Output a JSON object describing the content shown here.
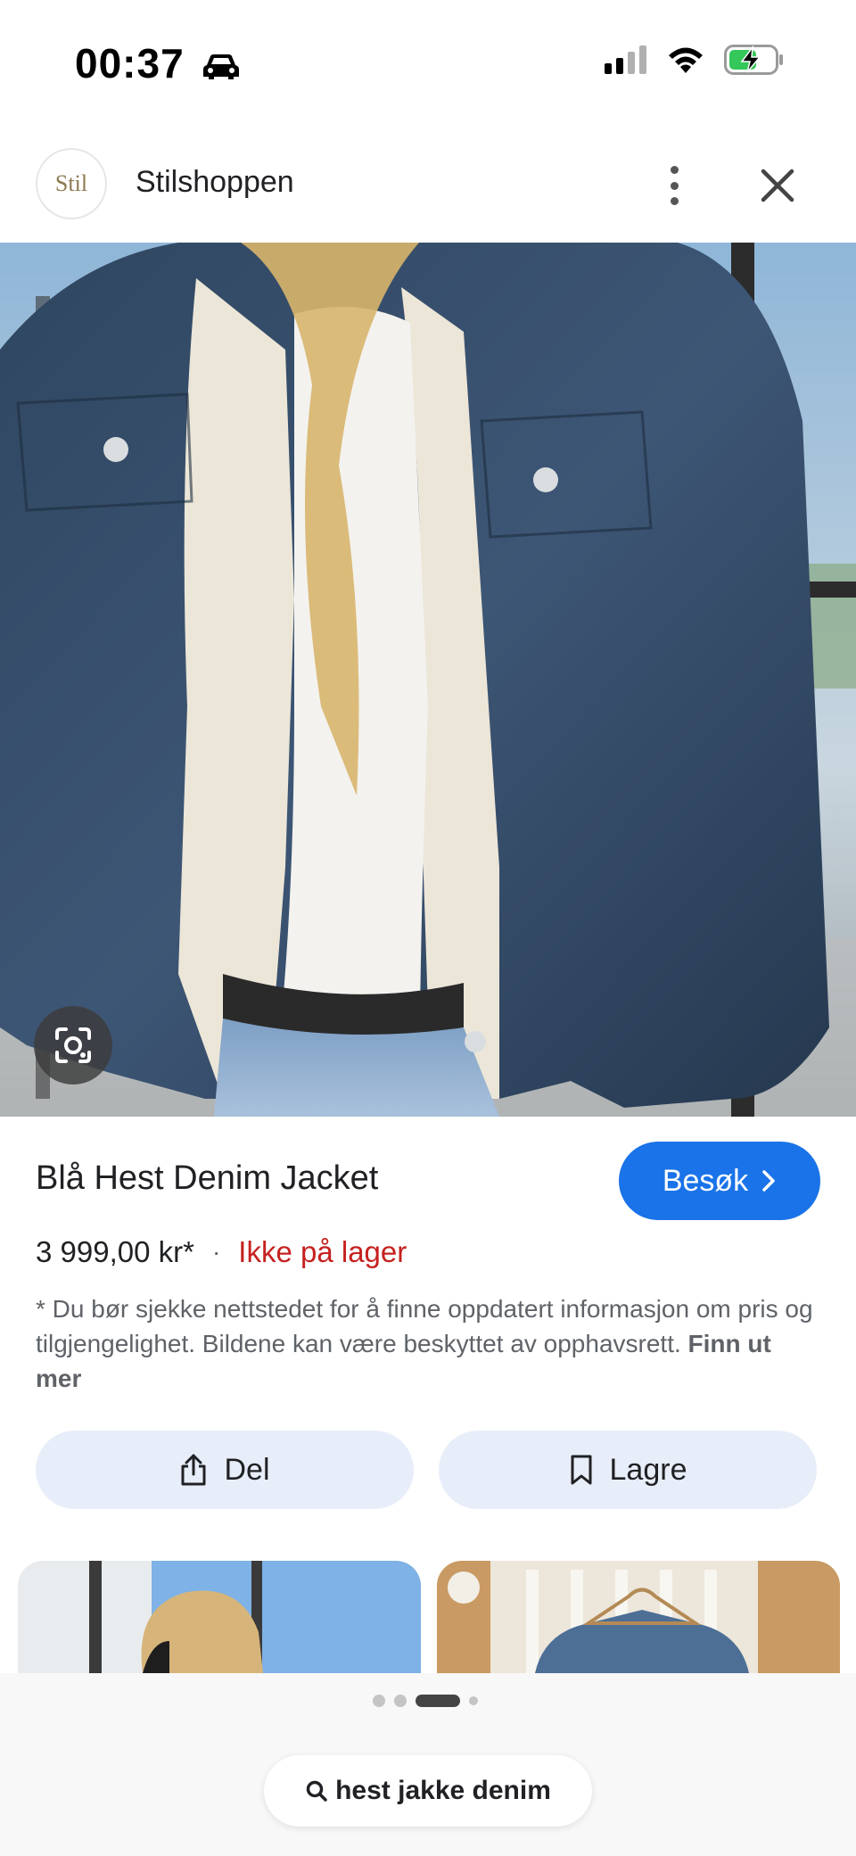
{
  "status_bar": {
    "time": "00:37"
  },
  "header": {
    "logo_text": "Stil",
    "site_name": "Stilshoppen"
  },
  "product": {
    "title": "Blå Hest Denim Jacket",
    "visit_label": "Besøk",
    "price": "3 999,00 kr*",
    "separator": "·",
    "stock_status": "Ikke på lager",
    "disclaimer": "* Du bør sjekke nettstedet for å finne oppdatert informasjon om pris og tilgjengelighet. Bildene kan være beskyttet av opphavsrett.",
    "learn_more": "Finn ut mer"
  },
  "actions": {
    "share_label": "Del",
    "save_label": "Lagre"
  },
  "search": {
    "query": "hest jakke denim"
  },
  "colors": {
    "accent": "#1a73e8",
    "out_of_stock": "#c5221f",
    "pill_bg": "#e8eef9"
  },
  "icons": {
    "status": [
      "car-icon",
      "signal-icon",
      "wifi-icon",
      "battery-charging-icon"
    ],
    "header": [
      "more-vert-icon",
      "close-icon"
    ],
    "lens": "google-lens-icon",
    "visit": "chevron-right-icon",
    "share": "share-icon",
    "save": "bookmark-icon",
    "search": "search-icon"
  }
}
